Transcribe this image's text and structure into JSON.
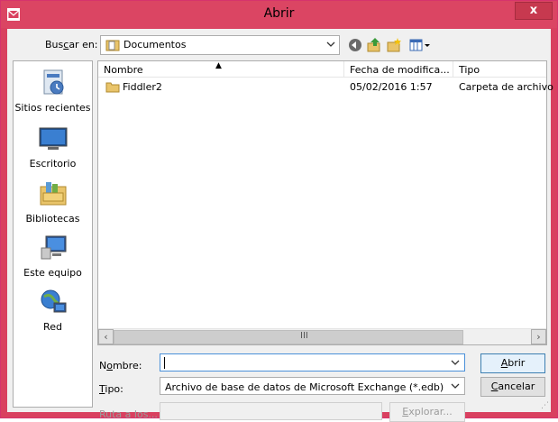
{
  "window": {
    "title": "Abrir",
    "close_label": "x",
    "accent": "#d9405f"
  },
  "toolbar": {
    "look_in_label": "Buscar en:",
    "look_in_value": "Documentos",
    "icons": [
      "back-arrow-icon",
      "up-folder-icon",
      "new-folder-icon",
      "view-menu-icon"
    ]
  },
  "places": [
    {
      "label": "Sitios recientes",
      "icon": "recent-places-icon"
    },
    {
      "label": "Escritorio",
      "icon": "desktop-icon"
    },
    {
      "label": "Bibliotecas",
      "icon": "libraries-icon"
    },
    {
      "label": "Este equipo",
      "icon": "computer-icon"
    },
    {
      "label": "Red",
      "icon": "network-icon"
    }
  ],
  "file_list": {
    "columns": [
      "Nombre",
      "Fecha de modifica...",
      "Tipo"
    ],
    "sort_indicator": "▲",
    "rows": [
      {
        "name": "Fiddler2",
        "date": "05/02/2016 1:57",
        "type": "Carpeta de archivo"
      }
    ],
    "scroll_grip": "III"
  },
  "form": {
    "name_label": "Nombre:",
    "name_value": "",
    "type_label": "Tipo:",
    "type_value": "Archivo de base de datos de Microsoft Exchange (*.edb)",
    "path_label": "Ruta a los...",
    "open_label": "Abrir",
    "cancel_label": "Cancelar",
    "browse_label": "Explorar..."
  }
}
